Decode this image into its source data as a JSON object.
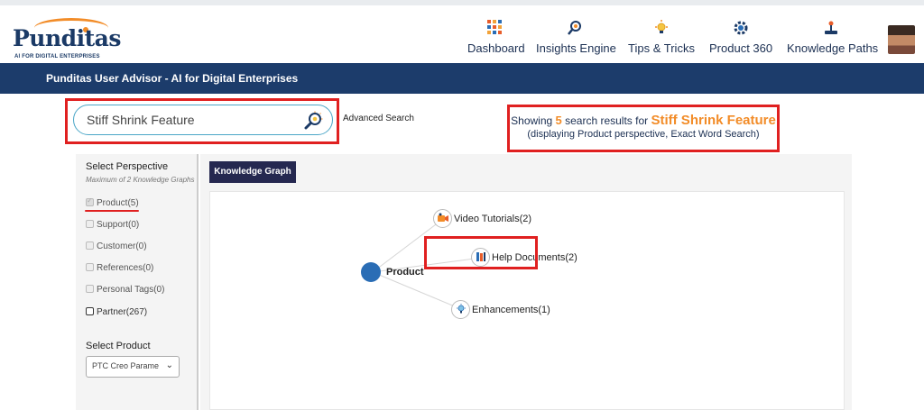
{
  "header": {
    "logo_text": "Punditas",
    "logo_tagline": "AI FOR DIGITAL ENTERPRISES",
    "nav": [
      {
        "label": "Dashboard",
        "icon": "dashboard-grid-icon"
      },
      {
        "label": "Insights Engine",
        "icon": "insights-magnifier-icon"
      },
      {
        "label": "Tips & Tricks",
        "icon": "lightbulb-icon"
      },
      {
        "label": "Product 360",
        "icon": "product-gear-icon"
      },
      {
        "label": "Knowledge Paths",
        "icon": "joystick-icon"
      }
    ]
  },
  "subheader": {
    "title": "Punditas User Advisor - AI for Digital Enterprises"
  },
  "search": {
    "value": "Stiff Shrink Feature",
    "advanced_label": "Advanced Search"
  },
  "results": {
    "prefix": "Showing",
    "count": "5",
    "middle": "search results for",
    "term": "Stiff Shrink Feature",
    "detail": "(displaying Product perspective, Exact Word Search)"
  },
  "sidebar": {
    "perspective_title": "Select Perspective",
    "perspective_note": "Maximum of 2 Knowledge Graphs",
    "options": [
      {
        "label": "Product(5)",
        "checked": true,
        "enabled": false
      },
      {
        "label": "Support(0)",
        "checked": false,
        "enabled": false
      },
      {
        "label": "Customer(0)",
        "checked": false,
        "enabled": false
      },
      {
        "label": "References(0)",
        "checked": false,
        "enabled": false
      },
      {
        "label": "Personal Tags(0)",
        "checked": false,
        "enabled": false
      },
      {
        "label": "Partner(267)",
        "checked": false,
        "enabled": true
      }
    ],
    "product_title": "Select Product",
    "product_selected": "PTC Creo Parame"
  },
  "graph": {
    "tab_label": "Knowledge Graph",
    "root": {
      "label": "Product",
      "color": "#2a6db5"
    },
    "children": [
      {
        "label": "Video Tutorials(2)",
        "icon": "video-tutorial-icon"
      },
      {
        "label": "Help Documents(2)",
        "icon": "help-documents-icon"
      },
      {
        "label": "Enhancements(1)",
        "icon": "enhancement-bulb-icon"
      }
    ]
  },
  "colors": {
    "brand_navy": "#1c3c6b",
    "accent_orange": "#f28c28",
    "highlight_red": "#e02020",
    "tab_dark": "#252850"
  }
}
